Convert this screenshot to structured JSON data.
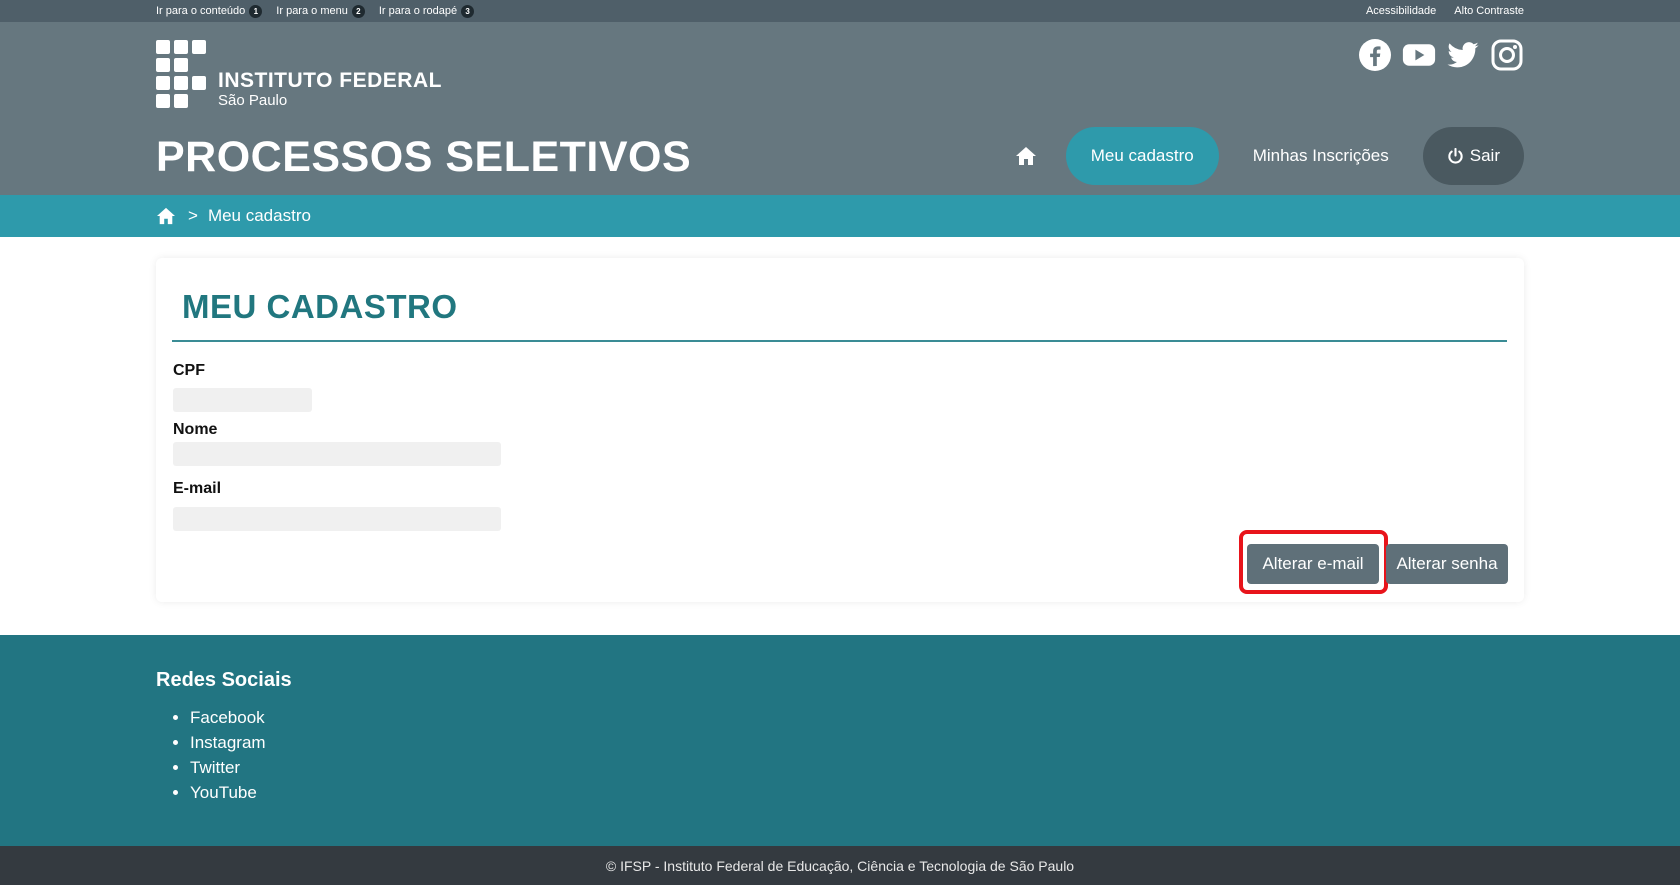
{
  "topbar": {
    "skip_links": [
      {
        "label": "Ir para o conteúdo",
        "num": "1"
      },
      {
        "label": "Ir para o menu",
        "num": "2"
      },
      {
        "label": "Ir para o rodapé",
        "num": "3"
      }
    ],
    "accessibility": "Acessibilidade",
    "high_contrast": "Alto Contraste"
  },
  "logo": {
    "line1": "INSTITUTO FEDERAL",
    "line2": "São Paulo"
  },
  "social_icons": [
    "facebook-icon",
    "youtube-icon",
    "twitter-icon",
    "instagram-icon"
  ],
  "site_title": "PROCESSOS SELETIVOS",
  "nav": {
    "home_icon": "home-icon",
    "my_registration": "Meu cadastro",
    "my_subscriptions": "Minhas Inscrições",
    "logout": "Sair"
  },
  "breadcrumb": {
    "sep": ">",
    "current": "Meu cadastro"
  },
  "card": {
    "title": "MEU CADASTRO",
    "fields": {
      "cpf_label": "CPF",
      "cpf_value": "",
      "name_label": "Nome",
      "name_value": "",
      "email_label": "E-mail",
      "email_value": ""
    },
    "change_email": "Alterar e-mail",
    "change_password": "Alterar senha"
  },
  "footer": {
    "social_heading": "Redes Sociais",
    "links": [
      "Facebook",
      "Instagram",
      "Twitter",
      "YouTube"
    ],
    "copyright": "© IFSP - Instituto Federal de Educação, Ciência e Tecnologia de São Paulo"
  },
  "colors": {
    "header": "#66777f",
    "accent": "#2e9aab",
    "title": "#21777f",
    "footer": "#227582",
    "highlight": "#e8141b"
  }
}
